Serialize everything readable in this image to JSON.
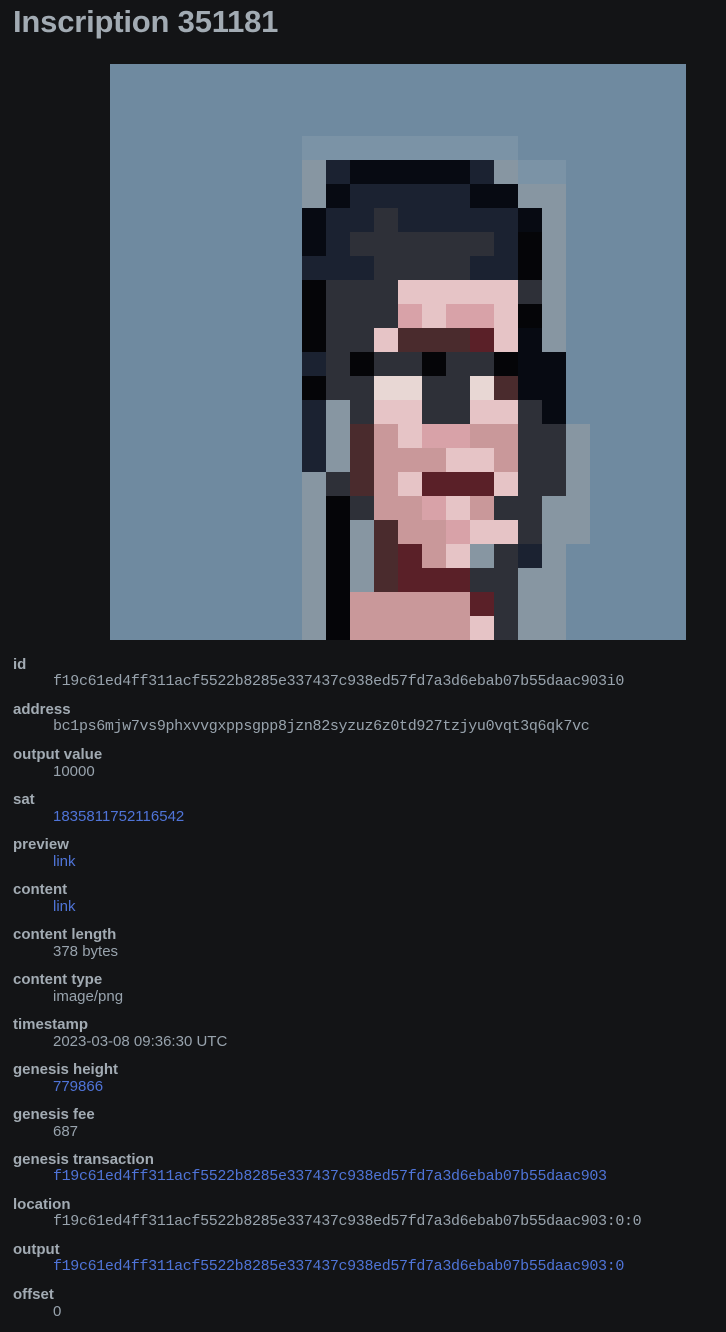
{
  "page": {
    "title": "Inscription 351181"
  },
  "preview": {
    "kind": "pixelated-portrait",
    "palette": {
      "background": "#6f8aa0",
      "background_light": "#7b93a6",
      "hair": "#1b2231",
      "hair_dark": "#070a12",
      "shadow": "#2e3038",
      "skin": "#c9989a",
      "skin_light": "#e6c4c6",
      "skin_pink": "#d8a2a8",
      "lip": "#5a2028",
      "eye": "#4a2b2d",
      "white": "#e8d7d4",
      "grey": "#8796a2",
      "dark": "#050508"
    }
  },
  "details": {
    "id": {
      "label": "id",
      "value": "f19c61ed4ff311acf5522b8285e337437c938ed57fd7a3d6ebab07b55daac903i0"
    },
    "address": {
      "label": "address",
      "value": "bc1ps6mjw7vs9phxvvgxppsgpp8jzn82syzuz6z0td927tzjyu0vqt3q6qk7vc"
    },
    "output_value": {
      "label": "output value",
      "value": "10000"
    },
    "sat": {
      "label": "sat",
      "value": "1835811752116542"
    },
    "preview": {
      "label": "preview",
      "value": "link"
    },
    "content": {
      "label": "content",
      "value": "link"
    },
    "content_length": {
      "label": "content length",
      "value": "378 bytes"
    },
    "content_type": {
      "label": "content type",
      "value": "image/png"
    },
    "timestamp": {
      "label": "timestamp",
      "value": "2023-03-08 09:36:30 UTC"
    },
    "genesis_height": {
      "label": "genesis height",
      "value": "779866"
    },
    "genesis_fee": {
      "label": "genesis fee",
      "value": "687"
    },
    "genesis_transaction": {
      "label": "genesis transaction",
      "value": "f19c61ed4ff311acf5522b8285e337437c938ed57fd7a3d6ebab07b55daac903"
    },
    "location": {
      "label": "location",
      "value": "f19c61ed4ff311acf5522b8285e337437c938ed57fd7a3d6ebab07b55daac903:0:0"
    },
    "output": {
      "label": "output",
      "value": "f19c61ed4ff311acf5522b8285e337437c938ed57fd7a3d6ebab07b55daac903:0"
    },
    "offset": {
      "label": "offset",
      "value": "0"
    }
  },
  "colors": {
    "page_background": "#131416",
    "text": "#98a3ad",
    "heading": "#a2abb3",
    "link": "#4f74d8"
  }
}
